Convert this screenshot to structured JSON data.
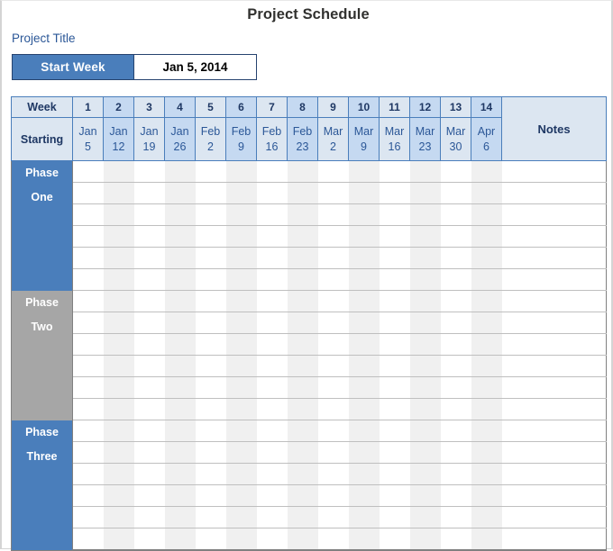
{
  "page": {
    "title": "Project Schedule",
    "project_title_label": "Project Title"
  },
  "start_week": {
    "label": "Start Week",
    "value": "Jan 5, 2014"
  },
  "table": {
    "row_header_week": "Week",
    "row_header_starting": "Starting",
    "notes_header": "Notes",
    "weeks": [
      {
        "number": "1",
        "month": "Jan",
        "day": "5"
      },
      {
        "number": "2",
        "month": "Jan",
        "day": "12"
      },
      {
        "number": "3",
        "month": "Jan",
        "day": "19"
      },
      {
        "number": "4",
        "month": "Jan",
        "day": "26"
      },
      {
        "number": "5",
        "month": "Feb",
        "day": "2"
      },
      {
        "number": "6",
        "month": "Feb",
        "day": "9"
      },
      {
        "number": "7",
        "month": "Feb",
        "day": "16"
      },
      {
        "number": "8",
        "month": "Feb",
        "day": "23"
      },
      {
        "number": "9",
        "month": "Mar",
        "day": "2"
      },
      {
        "number": "10",
        "month": "Mar",
        "day": "9"
      },
      {
        "number": "11",
        "month": "Mar",
        "day": "16"
      },
      {
        "number": "12",
        "month": "Mar",
        "day": "23"
      },
      {
        "number": "13",
        "month": "Mar",
        "day": "30"
      },
      {
        "number": "14",
        "month": "Apr",
        "day": "6"
      }
    ],
    "phases": [
      {
        "line1": "Phase",
        "line2": "One",
        "color": "#4a7ebb",
        "rows": 6
      },
      {
        "line1": "Phase",
        "line2": "Two",
        "color": "#a6a6a6",
        "rows": 6
      },
      {
        "line1": "Phase",
        "line2": "Three",
        "color": "#4a7ebb",
        "rows": 6
      }
    ]
  },
  "colors": {
    "accent_blue": "#4a7ebb",
    "header_light": "#dce6f1",
    "header_alt": "#c5d9f1",
    "phase_gray": "#a6a6a6",
    "title_text": "#31312f",
    "label_blue": "#2b5797",
    "cell_alt": "#f0f0f0"
  }
}
